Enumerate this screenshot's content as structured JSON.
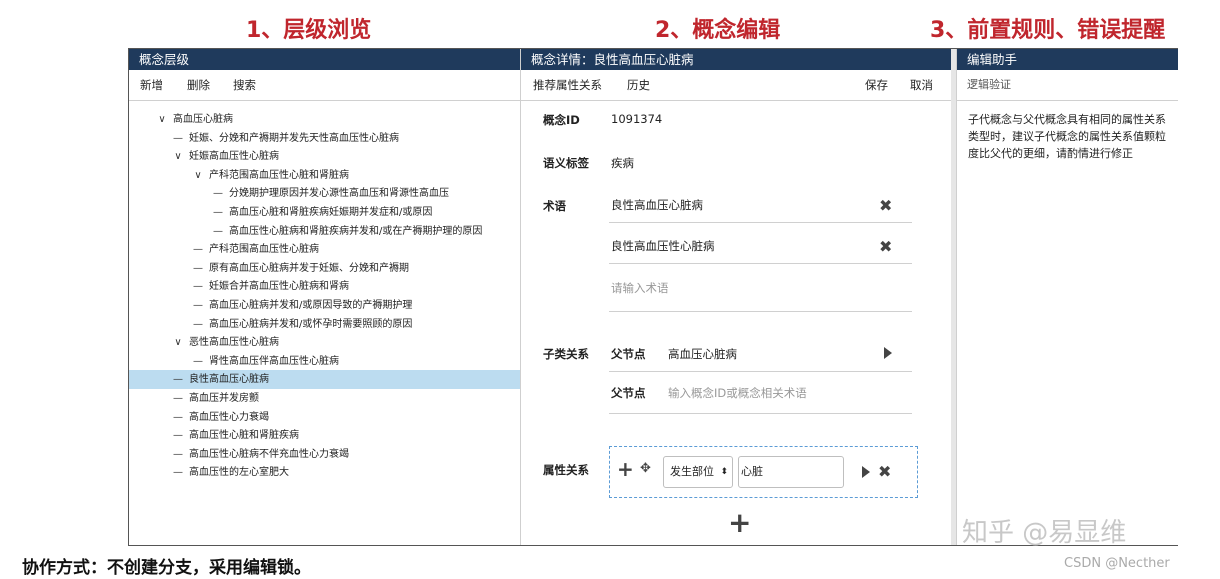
{
  "headings": {
    "h1": "1、层级浏览",
    "h2": "2、概念编辑",
    "h3": "3、前置规则、错误提醒"
  },
  "hierarchy": {
    "title": "概念层级",
    "toolbar": {
      "add": "新增",
      "delete": "删除",
      "search": "搜索"
    },
    "nodes": [
      {
        "prefix": "∨",
        "text": "高血压心脏病"
      },
      {
        "prefix": "—",
        "text": "妊娠、分娩和产褥期并发先天性高血压性心脏病"
      },
      {
        "prefix": "∨",
        "text": "妊娠高血压性心脏病"
      },
      {
        "prefix": "∨",
        "text": "产科范围高血压性心脏和肾脏病"
      },
      {
        "prefix": "—",
        "text": "分娩期护理原因并发心源性高血压和肾源性高血压"
      },
      {
        "prefix": "—",
        "text": "高血压心脏和肾脏疾病妊娠期并发症和/或原因"
      },
      {
        "prefix": "—",
        "text": "高血压性心脏病和肾脏疾病并发和/或在产褥期护理的原因"
      },
      {
        "prefix": "—",
        "text": "产科范围高血压性心脏病"
      },
      {
        "prefix": "—",
        "text": "原有高血压心脏病并发于妊娠、分娩和产褥期"
      },
      {
        "prefix": "—",
        "text": "妊娠合并高血压性心脏病和肾病"
      },
      {
        "prefix": "—",
        "text": "高血压心脏病并发和/或原因导致的产褥期护理"
      },
      {
        "prefix": "—",
        "text": "高血压心脏病并发和/或怀孕时需要照顾的原因"
      },
      {
        "prefix": "∨",
        "text": "恶性高血压性心脏病"
      },
      {
        "prefix": "—",
        "text": "肾性高血压伴高血压性心脏病"
      },
      {
        "prefix": "—",
        "text": "良性高血压心脏病"
      },
      {
        "prefix": "—",
        "text": "高血压并发房颤"
      },
      {
        "prefix": "—",
        "text": "高血压性心力衰竭"
      },
      {
        "prefix": "—",
        "text": "高血压性心脏和肾脏疾病"
      },
      {
        "prefix": "—",
        "text": "高血压性心脏病不伴充血性心力衰竭"
      },
      {
        "prefix": "—",
        "text": "高血压性的左心室肥大"
      }
    ]
  },
  "details": {
    "title": "概念详情：良性高血压心脏病",
    "toolbar": {
      "recommend": "推荐属性关系",
      "history": "历史",
      "save": "保存",
      "cancel": "取消"
    },
    "concept_id_label": "概念ID",
    "concept_id": "1091374",
    "semantic_tag_label": "语义标签",
    "semantic_tag": "疾病",
    "terms_label": "术语",
    "terms": [
      "良性高血压心脏病",
      "良性高血压性心脏病"
    ],
    "term_placeholder": "请输入术语",
    "subclass_label": "子类关系",
    "parent_label": "父节点",
    "parent_value": "高血压心脏病",
    "parent2_label": "父节点",
    "parent_placeholder": "输入概念ID或概念相关术语",
    "attr_label": "属性关系",
    "attr_type": "发生部位",
    "attr_value": "心脏"
  },
  "assistant": {
    "title": "编辑助手",
    "tab": "逻辑验证",
    "message": "子代概念与父代概念具有相同的属性关系类型时，建议子代概念的属性关系值颗粒度比父代的更细，请酌情进行修正"
  },
  "footer": "协作方式：不创建分支，采用编辑锁。",
  "watermark": "知乎 @易显维",
  "watermark2": "CSDN @Necther"
}
